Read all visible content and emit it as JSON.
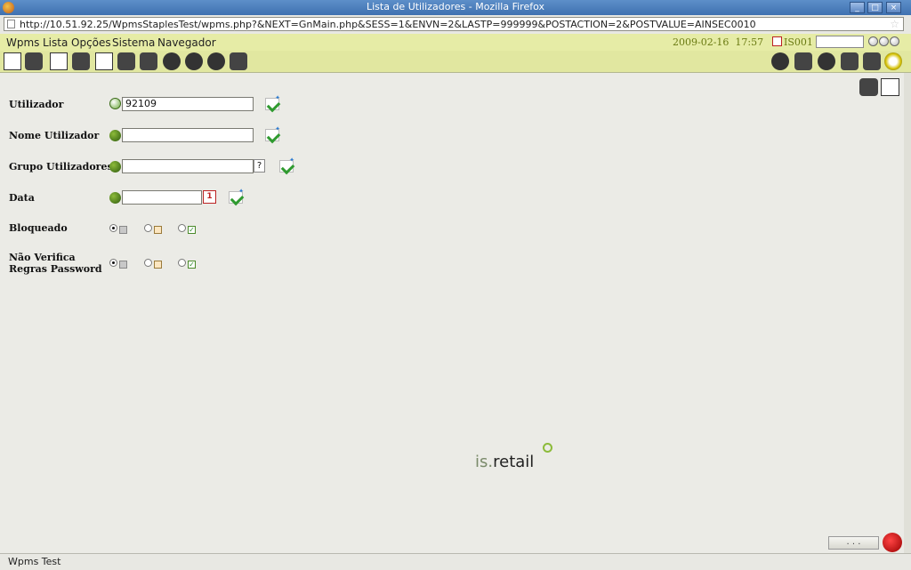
{
  "window": {
    "title": "Lista de Utilizadores - Mozilla Firefox"
  },
  "browser": {
    "url": "http://10.51.92.25/WpmsStaplesTest/wpms.php?&NEXT=GnMain.php&SESS=1&ENVN=2&LASTP=999999&POSTACTION=2&POSTVALUE=AINSEC0010"
  },
  "menu": {
    "items": [
      "Wpms",
      "Lista",
      "Opções",
      "Sistema",
      "Navegador"
    ]
  },
  "header": {
    "date": "2009-02-16",
    "time": "17:57",
    "store": "IS001",
    "search_value": ""
  },
  "toolbar": {
    "left_icons": [
      "report-icon",
      "binoculars-icon",
      "blank-page-icon",
      "edit-icon",
      "copy-page-icon",
      "keyboard-icon",
      "computer-icon",
      "tools-icon",
      "people-icon",
      "people-edit-icon",
      "stack-icon"
    ],
    "right_icons": [
      "refresh-icon",
      "print-icon",
      "help-icon",
      "user-icon",
      "stamp-icon",
      "exit-icon"
    ]
  },
  "form": {
    "utilizador": {
      "label": "Utilizador",
      "value": "92109"
    },
    "nome_utilizador": {
      "label": "Nome Utilizador",
      "value": ""
    },
    "grupo_utilizadores": {
      "label": "Grupo Utilizadores",
      "value": "",
      "lookup_label": "?"
    },
    "data": {
      "label": "Data",
      "value": "",
      "calendar_label": "1"
    },
    "bloqueado": {
      "label": "Bloqueado",
      "selected": 0
    },
    "nao_verifica_line1": "Não Verifica",
    "nao_verifica_line2": "Regras Password",
    "nao_verifica_selected": 0
  },
  "brand": {
    "part1": "is.",
    "part2": "retail"
  },
  "footer": {
    "dots_label": ". . ."
  },
  "status": {
    "text": "Wpms Test"
  },
  "colors": {
    "menubar": "#e6eca6",
    "toolbar": "#e1e7a0",
    "datetime": "#6a7a12",
    "background": "#ebebe6"
  }
}
